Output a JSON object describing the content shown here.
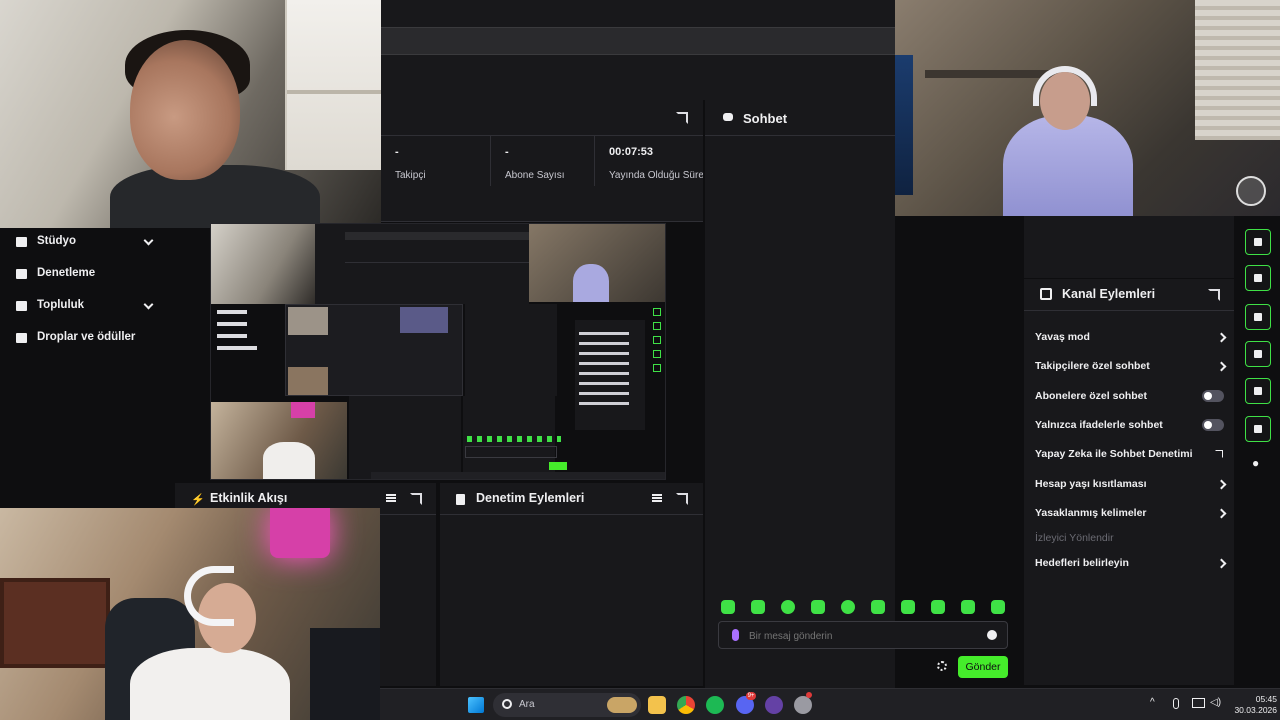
{
  "stats": {
    "followers_value": "-",
    "followers_label": "Takipçi",
    "subscribers_value": "-",
    "subscribers_label": "Abone Sayısı",
    "uptime_value": "00:07:53",
    "uptime_label": "Yayında Olduğu Süre"
  },
  "chat": {
    "title": "Sohbet",
    "input_placeholder": "Bir mesaj gönderin",
    "send_label": "Gönder"
  },
  "leftnav": {
    "items": [
      {
        "label": "Stüdyo"
      },
      {
        "label": "Denetleme"
      },
      {
        "label": "Topluluk"
      },
      {
        "label": "Droplar ve ödüller"
      }
    ]
  },
  "channel_actions": {
    "title": "Kanal Eylemleri",
    "rows": [
      {
        "label": "Yavaş mod",
        "control": "chevron"
      },
      {
        "label": "Takipçilere özel sohbet",
        "control": "chevron"
      },
      {
        "label": "Abonelere özel sohbet",
        "control": "toggle-off"
      },
      {
        "label": "Yalnızca ifadelerle sohbet",
        "control": "toggle-off"
      },
      {
        "label": "Yapay Zeka ile Sohbet Denetimi",
        "control": "external"
      },
      {
        "label": "Hesap yaşı kısıtlaması",
        "control": "chevron"
      },
      {
        "label": "Yasaklanmış kelimeler",
        "control": "chevron"
      },
      {
        "label": "İzleyici Yönlendir",
        "control": "none-disabled"
      },
      {
        "label": "Hedefleri belirleyin",
        "control": "chevron"
      }
    ]
  },
  "panels": {
    "activity_feed": "Etkinlik Akışı",
    "mod_actions": "Denetim Eylemleri"
  },
  "taskbar": {
    "search_label": "Ara",
    "discord_badge": "9+",
    "time": "05:45",
    "date": "30.03.2026"
  },
  "colors": {
    "accent_green": "#45ec2b",
    "background": "#0e0e10",
    "panel": "#18181b",
    "mic_purple": "#a970ff"
  },
  "icons": {
    "rail": [
      "lightning-icon",
      "notes-icon",
      "chat-icon",
      "broadcast-icon",
      "layout-icon",
      "wrench-icon"
    ]
  }
}
